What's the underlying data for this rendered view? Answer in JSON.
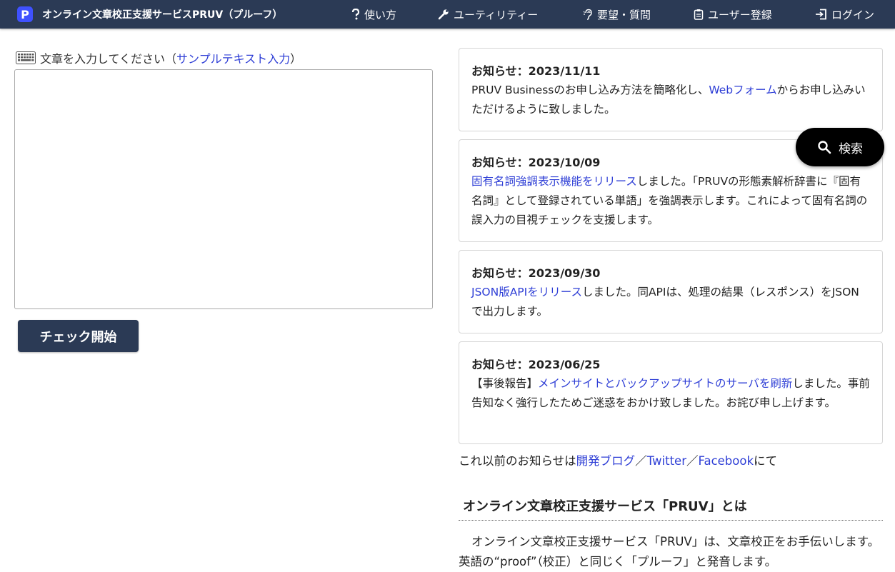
{
  "navbar": {
    "brand_logo": "P",
    "brand_title": "オンライン文章校正支援サービスPRUV（プルーフ）",
    "items": [
      {
        "label": "使い方",
        "icon": "question-icon"
      },
      {
        "label": "ユーティリティー",
        "icon": "wrench-icon"
      },
      {
        "label": "要望・質問",
        "icon": "ear-icon"
      },
      {
        "label": "ユーザー登録",
        "icon": "clipboard-icon"
      },
      {
        "label": "ログイン",
        "icon": "login-icon"
      }
    ]
  },
  "editor": {
    "label": "文章を入力してください（",
    "sample_link": "サンプルテキスト入力",
    "label_close": "）",
    "check_button": "チェック開始"
  },
  "notices": [
    {
      "date": "お知らせ：2023/11/11",
      "t1": "PRUV Businessのお申し込み方法を簡略化し、",
      "link": "Webフォーム",
      "t2": "からお申し込みいただけるように致しました。"
    },
    {
      "date": "お知らせ：2023/10/09",
      "t1": "",
      "link": "固有名詞強調表示機能をリリース",
      "t2": "しました。「PRUVの形態素解析辞書に『固有名詞』として登録されている単語」を強調表示します。これによって固有名詞の誤入力の目視チェックを支援します。"
    },
    {
      "date": "お知らせ：2023/09/30",
      "t1": "",
      "link": "JSON版APIをリリース",
      "t2": "しました。同APIは、処理の結果（レスポンス）をJSONで出力します。"
    },
    {
      "date": "お知らせ：2023/06/25",
      "t1": "【事後報告】",
      "link": "メインサイトとバックアップサイトのサーバを刷新",
      "t2": "しました。事前告知なく強行したためご迷惑をおかけ致しました。お詫び申し上げます。"
    }
  ],
  "older_notices": {
    "prefix": "これ以前のお知らせは",
    "link_blog": "開発ブログ",
    "sep1": "／",
    "link_twitter": "Twitter",
    "sep2": "／",
    "link_facebook": "Facebook",
    "suffix": "にて"
  },
  "about": {
    "heading": "オンライン文章校正支援サービス「PRUV」とは",
    "text": "オンライン文章校正支援サービス「PRUV」は、文章校正をお手伝いします。英語の“proof”（校正）と同じく「プルーフ」と発音します。"
  },
  "search_button": "検索",
  "colors": {
    "navbar": "#2b3a55",
    "logo": "#3f51ff",
    "link": "#2f3fd6",
    "search_button": "#000000"
  }
}
